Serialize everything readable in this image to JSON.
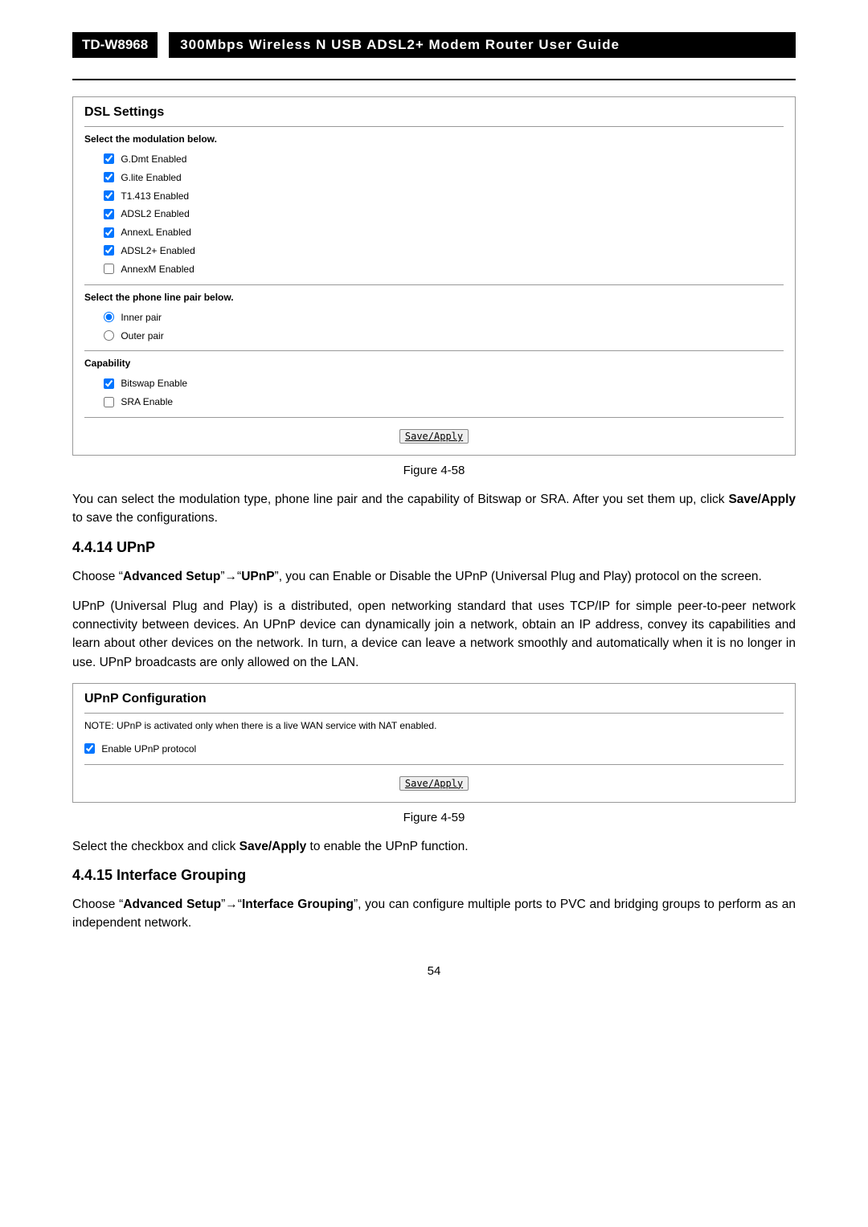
{
  "topbar": {
    "model": "TD-W8968",
    "title": "300Mbps Wireless N USB ADSL2+ Modem Router User Guide"
  },
  "dsl_panel": {
    "title": "DSL Settings",
    "section_mod": "Select the modulation below.",
    "mods": [
      {
        "label": "G.Dmt Enabled",
        "checked": true
      },
      {
        "label": "G.lite Enabled",
        "checked": true
      },
      {
        "label": "T1.413 Enabled",
        "checked": true
      },
      {
        "label": "ADSL2 Enabled",
        "checked": true
      },
      {
        "label": "AnnexL Enabled",
        "checked": true
      },
      {
        "label": "ADSL2+ Enabled",
        "checked": true
      },
      {
        "label": "AnnexM Enabled",
        "checked": false
      }
    ],
    "section_phone": "Select the phone line pair below.",
    "phone": [
      {
        "label": "Inner pair",
        "checked": true
      },
      {
        "label": "Outer pair",
        "checked": false
      }
    ],
    "section_cap": "Capability",
    "caps": [
      {
        "label": "Bitswap Enable",
        "checked": true
      },
      {
        "label": "SRA Enable",
        "checked": false
      }
    ],
    "save": "Save/Apply"
  },
  "fig458": "Figure 4-58",
  "para_after_458_a": "You can select the modulation type, phone line pair and the capability of Bitswap or SRA. After you set them up, click ",
  "para_after_458_bold": "Save/Apply",
  "para_after_458_b": " to save the configurations.",
  "heading_upnp": "4.4.14 UPnP",
  "upnp_choose_a": "Choose “",
  "upnp_choose_bold1": "Advanced Setup",
  "upnp_choose_mid": "”→“",
  "upnp_choose_bold2": "UPnP",
  "upnp_choose_b": "”, you can Enable or Disable the UPnP (Universal Plug and Play) protocol on the screen.",
  "upnp_para": "UPnP (Universal Plug and Play) is a distributed, open networking standard that uses TCP/IP for simple peer-to-peer network connectivity between devices. An UPnP device can dynamically join a network, obtain an IP address, convey its capabilities and learn about other devices on the network. In turn, a device can leave a network smoothly and automatically when it is no longer in use. UPnP broadcasts are only allowed on the LAN.",
  "upnp_panel": {
    "title": "UPnP Configuration",
    "note": "NOTE: UPnP is activated only when there is a live WAN service with NAT enabled.",
    "enable_label": "Enable UPnP protocol",
    "enable_checked": true,
    "save": "Save/Apply"
  },
  "fig459": "Figure 4-59",
  "para_after_459_a": "Select the checkbox and click ",
  "para_after_459_bold": "Save/Apply",
  "para_after_459_b": " to enable the UPnP function.",
  "heading_iface": "4.4.15 Interface Grouping",
  "iface_choose_a": "Choose “",
  "iface_choose_bold1": "Advanced Setup",
  "iface_choose_mid": "”→“",
  "iface_choose_bold2": "Interface Grouping",
  "iface_choose_b": "”, you can configure multiple ports to PVC and bridging groups to perform as an independent network.",
  "page_number": "54"
}
